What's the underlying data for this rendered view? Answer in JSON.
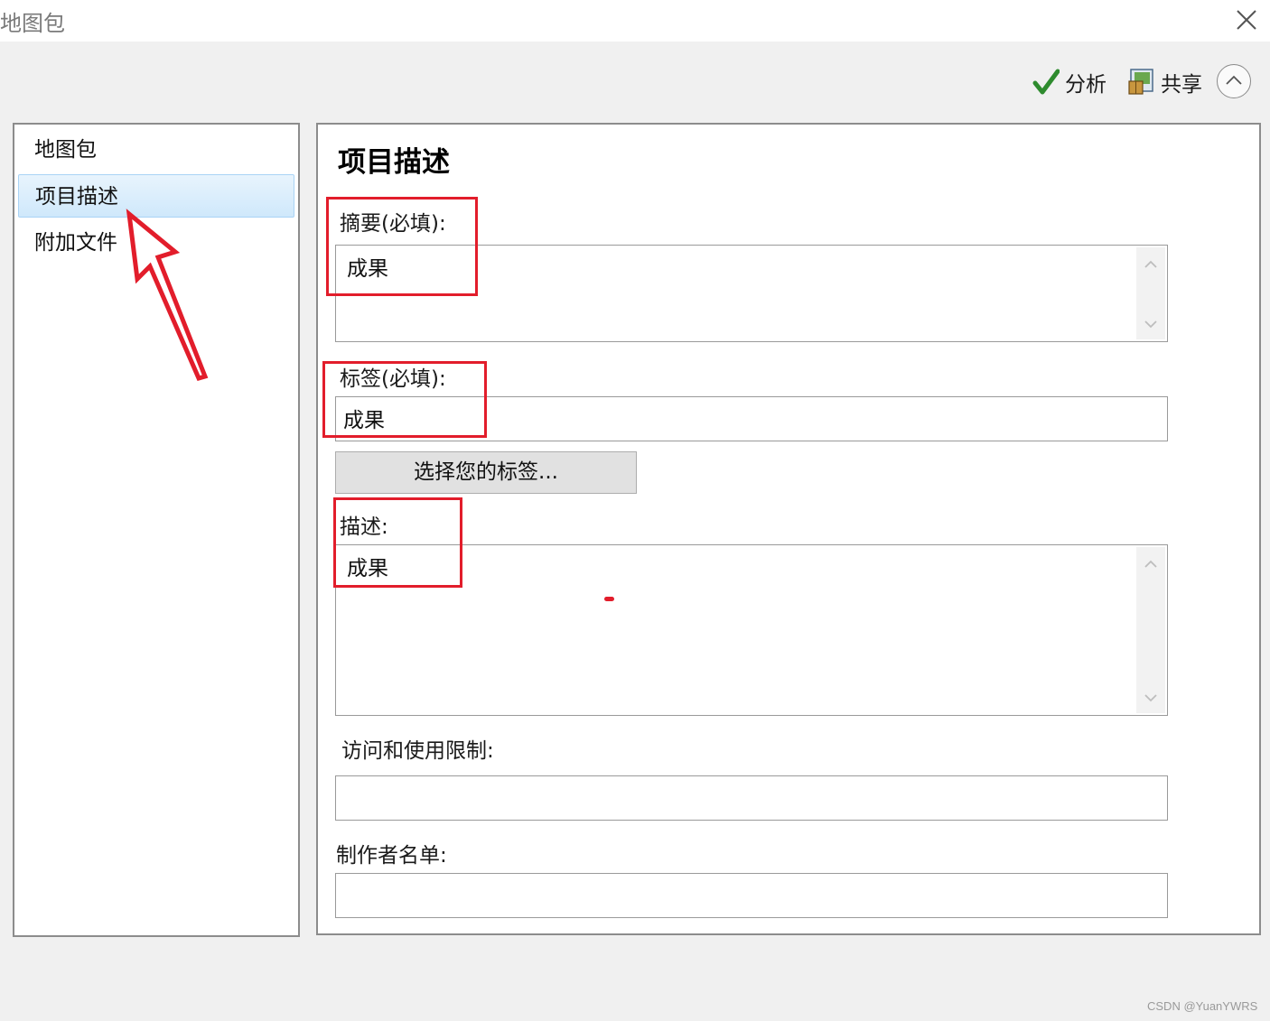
{
  "window": {
    "title": "地图包"
  },
  "toolbar": {
    "analyze_label": "分析",
    "share_label": "共享"
  },
  "nav": {
    "items": [
      {
        "label": "地图包"
      },
      {
        "label": "项目描述"
      },
      {
        "label": "附加文件"
      }
    ]
  },
  "main": {
    "title": "项目描述",
    "summary": {
      "label": "摘要(必填):",
      "value": "成果"
    },
    "tags": {
      "label": "标签(必填):",
      "value": "成果",
      "choose_button": "选择您的标签..."
    },
    "description": {
      "label": "描述:",
      "value": "成果"
    },
    "access": {
      "label": "访问和使用限制:",
      "value": ""
    },
    "credits": {
      "label": "制作者名单:",
      "value": ""
    }
  },
  "annotation_color": "#e21d2b",
  "watermark": "CSDN @YuanYWRS"
}
